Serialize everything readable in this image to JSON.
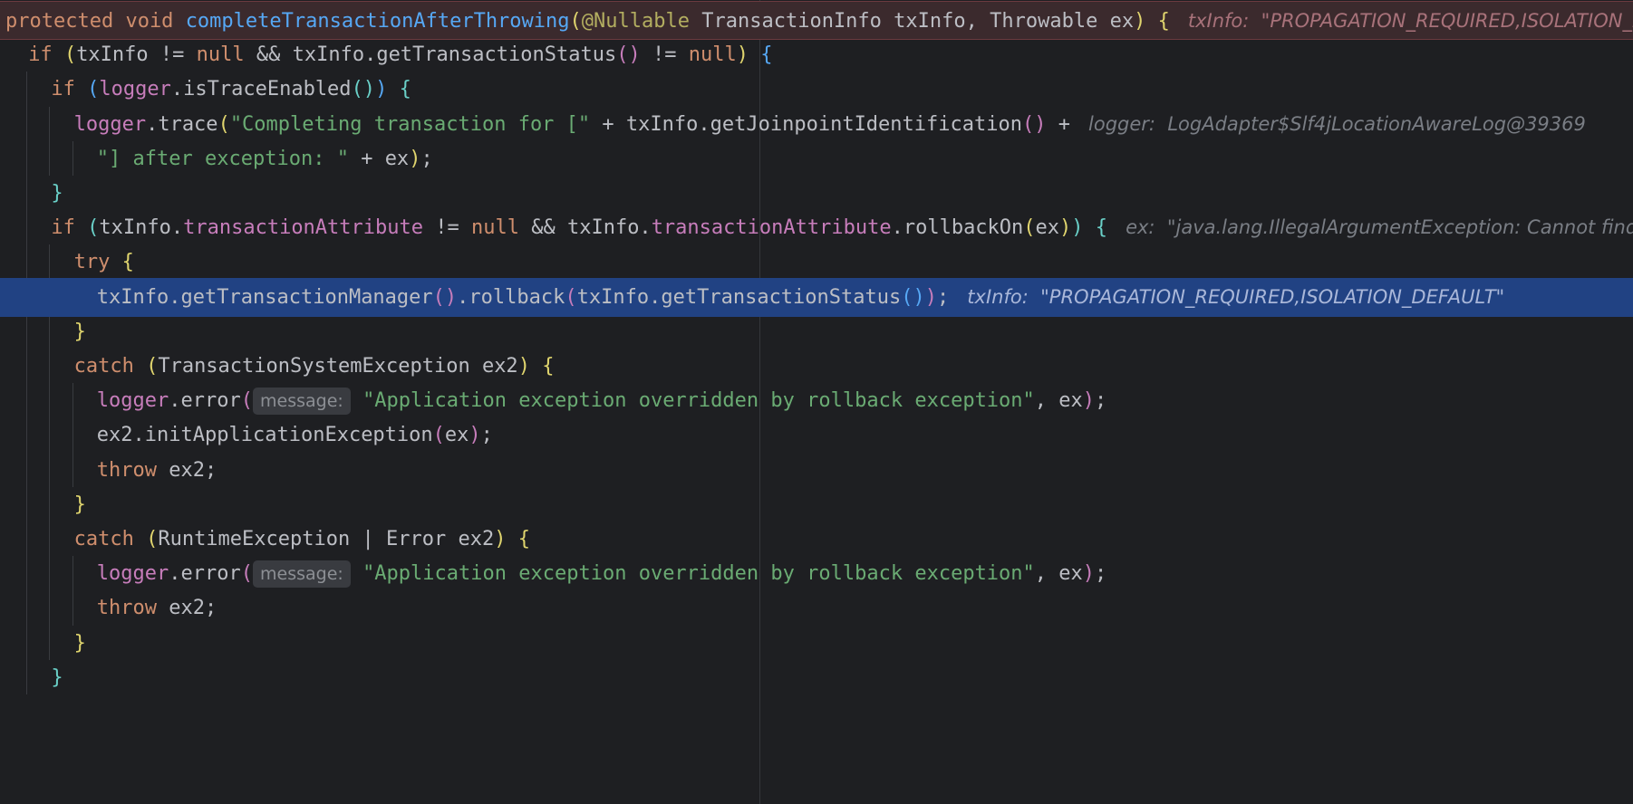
{
  "editor": {
    "lines": [
      {
        "id": "line-1",
        "variant": "first",
        "indent": 0,
        "segments": [
          {
            "t": "kw",
            "v": "protected void "
          },
          {
            "t": "fn",
            "v": "completeTransactionAfterThrowing"
          },
          {
            "t": "br1",
            "v": "("
          },
          {
            "t": "ann",
            "v": "@Nullable"
          },
          {
            "t": "plain",
            "v": " TransactionInfo txInfo, Throwable ex"
          },
          {
            "t": "br1",
            "v": ")"
          },
          {
            "t": "plain",
            "v": " "
          },
          {
            "t": "br1",
            "v": "{"
          },
          {
            "t": "hint",
            "v": "   txInfo:  \"PROPAGATION_REQUIRED,ISOLATION_DEFAULT\""
          }
        ]
      },
      {
        "id": "line-2",
        "indent": 1,
        "segments": [
          {
            "t": "kw",
            "v": "if "
          },
          {
            "t": "br1",
            "v": "("
          },
          {
            "t": "plain",
            "v": "txInfo != "
          },
          {
            "t": "kw",
            "v": "null"
          },
          {
            "t": "plain",
            "v": " && txInfo.getTransactionStatus"
          },
          {
            "t": "br2",
            "v": "()"
          },
          {
            "t": "plain",
            "v": " != "
          },
          {
            "t": "kw",
            "v": "null"
          },
          {
            "t": "br1",
            "v": ")"
          },
          {
            "t": "plain",
            "v": " "
          },
          {
            "t": "br3",
            "v": "{"
          }
        ]
      },
      {
        "id": "line-3",
        "indent": 2,
        "segments": [
          {
            "t": "kw",
            "v": "if "
          },
          {
            "t": "br3",
            "v": "("
          },
          {
            "t": "fld",
            "v": "logger"
          },
          {
            "t": "plain",
            "v": ".isTraceEnabled"
          },
          {
            "t": "br4",
            "v": "()"
          },
          {
            "t": "br3",
            "v": ")"
          },
          {
            "t": "plain",
            "v": " "
          },
          {
            "t": "br4",
            "v": "{"
          }
        ]
      },
      {
        "id": "line-4",
        "indent": 3,
        "segments": [
          {
            "t": "fld",
            "v": "logger"
          },
          {
            "t": "plain",
            "v": ".trace"
          },
          {
            "t": "br1",
            "v": "("
          },
          {
            "t": "str",
            "v": "\"Completing transaction for [\""
          },
          {
            "t": "plain",
            "v": " + txInfo.getJoinpointIdentification"
          },
          {
            "t": "br2",
            "v": "()"
          },
          {
            "t": "plain",
            "v": " +"
          },
          {
            "t": "hint",
            "v": "   logger:  LogAdapter$Slf4jLocationAwareLog@39369"
          }
        ]
      },
      {
        "id": "line-5",
        "indent": 4,
        "segments": [
          {
            "t": "str",
            "v": "\"] after exception: \""
          },
          {
            "t": "plain",
            "v": " + ex"
          },
          {
            "t": "br1",
            "v": ")"
          },
          {
            "t": "plain",
            "v": ";"
          }
        ]
      },
      {
        "id": "line-6",
        "indent": 2,
        "segments": [
          {
            "t": "br4",
            "v": "}"
          }
        ]
      },
      {
        "id": "line-7",
        "indent": 2,
        "segments": [
          {
            "t": "kw",
            "v": "if "
          },
          {
            "t": "br4",
            "v": "("
          },
          {
            "t": "plain",
            "v": "txInfo."
          },
          {
            "t": "fld",
            "v": "transactionAttribute"
          },
          {
            "t": "plain",
            "v": " != "
          },
          {
            "t": "kw",
            "v": "null"
          },
          {
            "t": "plain",
            "v": " && txInfo."
          },
          {
            "t": "fld",
            "v": "transactionAttribute"
          },
          {
            "t": "plain",
            "v": ".rollbackOn"
          },
          {
            "t": "br1",
            "v": "("
          },
          {
            "t": "plain",
            "v": "ex"
          },
          {
            "t": "br1",
            "v": ")"
          },
          {
            "t": "br4",
            "v": ")"
          },
          {
            "t": "plain",
            "v": " "
          },
          {
            "t": "br4",
            "v": "{"
          },
          {
            "t": "hint",
            "v": "   ex:  \"java.lang.IllegalArgumentException: Cannot find cache named"
          }
        ]
      },
      {
        "id": "line-8",
        "indent": 3,
        "segments": [
          {
            "t": "kw",
            "v": "try "
          },
          {
            "t": "br1",
            "v": "{"
          }
        ]
      },
      {
        "id": "line-9",
        "variant": "current",
        "indent": 4,
        "segments": [
          {
            "t": "plain",
            "v": "txInfo.getTransactionManager"
          },
          {
            "t": "br2",
            "v": "()"
          },
          {
            "t": "plain",
            "v": ".rollback"
          },
          {
            "t": "br2",
            "v": "("
          },
          {
            "t": "plain",
            "v": "txInfo.getTransactionStatus"
          },
          {
            "t": "br3",
            "v": "()"
          },
          {
            "t": "br2",
            "v": ")"
          },
          {
            "t": "plain",
            "v": ";"
          },
          {
            "t": "hint",
            "v": "   txInfo:  \"PROPAGATION_REQUIRED,ISOLATION_DEFAULT\""
          }
        ]
      },
      {
        "id": "line-10",
        "indent": 3,
        "segments": [
          {
            "t": "br1",
            "v": "}"
          }
        ]
      },
      {
        "id": "line-11",
        "indent": 3,
        "segments": [
          {
            "t": "kw",
            "v": "catch "
          },
          {
            "t": "br1",
            "v": "("
          },
          {
            "t": "plain",
            "v": "TransactionSystemException ex2"
          },
          {
            "t": "br1",
            "v": ")"
          },
          {
            "t": "plain",
            "v": " "
          },
          {
            "t": "br1",
            "v": "{"
          }
        ]
      },
      {
        "id": "line-12",
        "indent": 4,
        "segments": [
          {
            "t": "fld",
            "v": "logger"
          },
          {
            "t": "plain",
            "v": ".error"
          },
          {
            "t": "br2",
            "v": "("
          },
          {
            "t": "param",
            "v": "message:"
          },
          {
            "t": "plain",
            "v": " "
          },
          {
            "t": "str",
            "v": "\"Application exception overridden by rollback exception\""
          },
          {
            "t": "plain",
            "v": ", ex"
          },
          {
            "t": "br2",
            "v": ")"
          },
          {
            "t": "plain",
            "v": ";"
          }
        ]
      },
      {
        "id": "line-13",
        "indent": 4,
        "segments": [
          {
            "t": "plain",
            "v": "ex2.initApplicationException"
          },
          {
            "t": "br2",
            "v": "("
          },
          {
            "t": "plain",
            "v": "ex"
          },
          {
            "t": "br2",
            "v": ")"
          },
          {
            "t": "plain",
            "v": ";"
          }
        ]
      },
      {
        "id": "line-14",
        "indent": 4,
        "segments": [
          {
            "t": "kw",
            "v": "throw "
          },
          {
            "t": "plain",
            "v": "ex2;"
          }
        ]
      },
      {
        "id": "line-15",
        "indent": 3,
        "segments": [
          {
            "t": "br1",
            "v": "}"
          }
        ]
      },
      {
        "id": "line-16",
        "indent": 3,
        "segments": [
          {
            "t": "kw",
            "v": "catch "
          },
          {
            "t": "br1",
            "v": "("
          },
          {
            "t": "plain",
            "v": "RuntimeException | Error ex2"
          },
          {
            "t": "br1",
            "v": ")"
          },
          {
            "t": "plain",
            "v": " "
          },
          {
            "t": "br1",
            "v": "{"
          }
        ]
      },
      {
        "id": "line-17",
        "indent": 4,
        "segments": [
          {
            "t": "fld",
            "v": "logger"
          },
          {
            "t": "plain",
            "v": ".error"
          },
          {
            "t": "br2",
            "v": "("
          },
          {
            "t": "param",
            "v": "message:"
          },
          {
            "t": "plain",
            "v": " "
          },
          {
            "t": "str",
            "v": "\"Application exception overridden by rollback exception\""
          },
          {
            "t": "plain",
            "v": ", ex"
          },
          {
            "t": "br2",
            "v": ")"
          },
          {
            "t": "plain",
            "v": ";"
          }
        ]
      },
      {
        "id": "line-18",
        "indent": 4,
        "segments": [
          {
            "t": "kw",
            "v": "throw "
          },
          {
            "t": "plain",
            "v": "ex2;"
          }
        ]
      },
      {
        "id": "line-19",
        "indent": 3,
        "segments": [
          {
            "t": "br1",
            "v": "}"
          }
        ]
      },
      {
        "id": "line-20",
        "indent": 2,
        "segments": [
          {
            "t": "br4",
            "v": "}"
          }
        ]
      }
    ]
  }
}
